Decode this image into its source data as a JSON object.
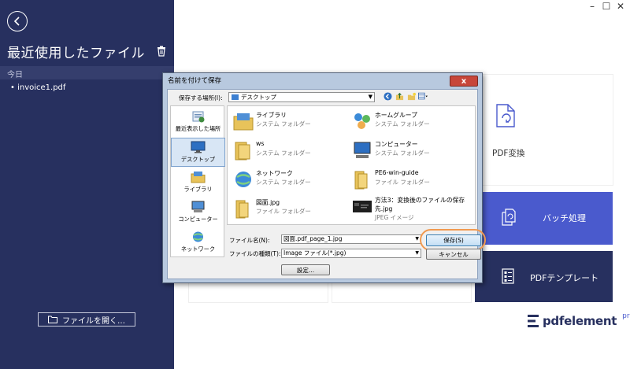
{
  "left_panel": {
    "title": "最近使用したファイル",
    "section_today": "今日",
    "recent_files": [
      "invoice1.pdf"
    ],
    "open_file_label": "ファイルを開く…"
  },
  "main": {
    "cards": {
      "pdf_convert": "PDF変換",
      "batch": "バッチ処理",
      "template": "PDFテンプレート"
    },
    "brand": {
      "name": "pdfelement",
      "edition": "pro"
    },
    "window_controls": [
      "minimize",
      "maximize",
      "close"
    ]
  },
  "dialog": {
    "title": "名前を付けて保存",
    "close_label": "x",
    "save_in_label": "保存する場所(I):",
    "location": "デスクトップ",
    "places": [
      "最近表示した場所",
      "デスクトップ",
      "ライブラリ",
      "コンピューター",
      "ネットワーク"
    ],
    "files": [
      {
        "name": "ライブラリ",
        "type": "システム フォルダー",
        "icon": "library-icon"
      },
      {
        "name": "ホームグループ",
        "type": "システム フォルダー",
        "icon": "homegroup-icon"
      },
      {
        "name": "ws",
        "type": "システム フォルダー",
        "icon": "user-folder-icon"
      },
      {
        "name": "コンピューター",
        "type": "システム フォルダー",
        "icon": "computer-icon"
      },
      {
        "name": "ネットワーク",
        "type": "システム フォルダー",
        "icon": "network-icon"
      },
      {
        "name": "PE6-win-guide",
        "type": "ファイル フォルダー",
        "icon": "folder-icon"
      },
      {
        "name": "図面.jpg",
        "type": "ファイル フォルダー",
        "icon": "folder-icon"
      },
      {
        "name": "方法3：変換後のファイルの保存",
        "name2": "先.jpg",
        "type": "JPEG イメージ",
        "icon": "image-thumbnail-icon"
      }
    ],
    "filename_label": "ファイル名(N):",
    "filename_value": "図面.pdf_page_1.jpg",
    "filetype_label": "ファイルの種類(T):",
    "filetype_value": "Image ファイル(*.jpg)",
    "save_label": "保存(S)",
    "cancel_label": "キャンセル",
    "settings_label": "設定..."
  },
  "colors": {
    "sidebar": "#27305f",
    "accent": "#4a5acd",
    "highlight": "#f19a50"
  }
}
